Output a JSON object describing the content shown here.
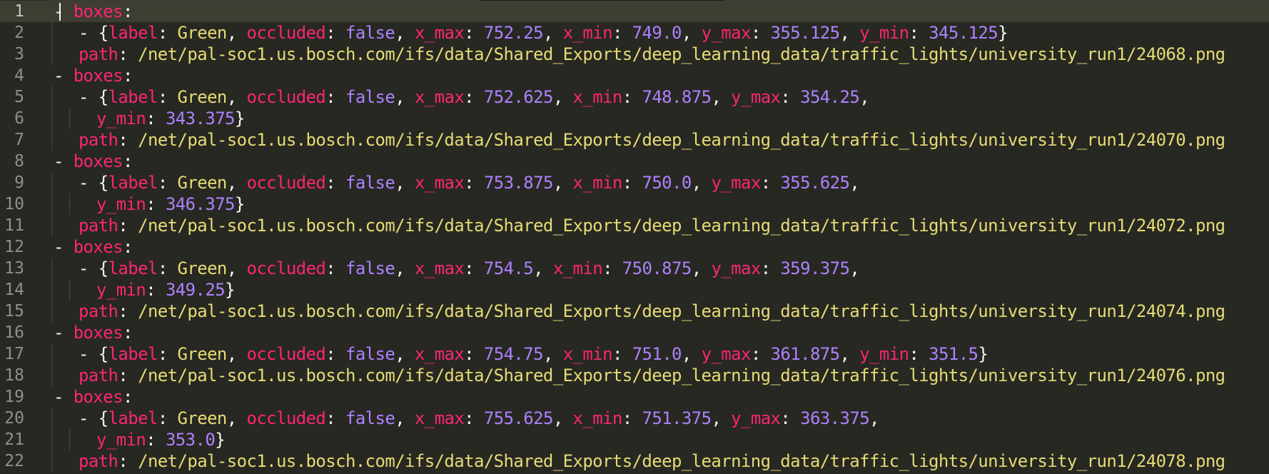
{
  "editor": {
    "active_line": 1,
    "lines": [
      {
        "n": "1",
        "indent": 0,
        "tokens": [
          [
            "p",
            "- "
          ],
          [
            "k",
            "boxes"
          ],
          [
            "p",
            ":"
          ]
        ]
      },
      {
        "n": "2",
        "indent": 1,
        "tokens": [
          [
            "p",
            "- {"
          ],
          [
            "k",
            "label"
          ],
          [
            "p",
            ": "
          ],
          [
            "s",
            "Green"
          ],
          [
            "p",
            ", "
          ],
          [
            "k",
            "occluded"
          ],
          [
            "p",
            ": "
          ],
          [
            "n",
            "false"
          ],
          [
            "p",
            ", "
          ],
          [
            "k",
            "x_max"
          ],
          [
            "p",
            ": "
          ],
          [
            "n",
            "752.25"
          ],
          [
            "p",
            ", "
          ],
          [
            "k",
            "x_min"
          ],
          [
            "p",
            ": "
          ],
          [
            "n",
            "749.0"
          ],
          [
            "p",
            ", "
          ],
          [
            "k",
            "y_max"
          ],
          [
            "p",
            ": "
          ],
          [
            "n",
            "355.125"
          ],
          [
            "p",
            ", "
          ],
          [
            "k",
            "y_min"
          ],
          [
            "p",
            ": "
          ],
          [
            "n",
            "345.125"
          ],
          [
            "p",
            "}"
          ]
        ]
      },
      {
        "n": "3",
        "indent": 1,
        "tokens": [
          [
            "k",
            "path"
          ],
          [
            "p",
            ": "
          ],
          [
            "s",
            "/net/pal-soc1.us.bosch.com/ifs/data/Shared_Exports/deep_learning_data/traffic_lights/university_run1/24068.png"
          ]
        ]
      },
      {
        "n": "4",
        "indent": 0,
        "tokens": [
          [
            "p",
            "- "
          ],
          [
            "k",
            "boxes"
          ],
          [
            "p",
            ":"
          ]
        ]
      },
      {
        "n": "5",
        "indent": 1,
        "tokens": [
          [
            "p",
            "- {"
          ],
          [
            "k",
            "label"
          ],
          [
            "p",
            ": "
          ],
          [
            "s",
            "Green"
          ],
          [
            "p",
            ", "
          ],
          [
            "k",
            "occluded"
          ],
          [
            "p",
            ": "
          ],
          [
            "n",
            "false"
          ],
          [
            "p",
            ", "
          ],
          [
            "k",
            "x_max"
          ],
          [
            "p",
            ": "
          ],
          [
            "n",
            "752.625"
          ],
          [
            "p",
            ", "
          ],
          [
            "k",
            "x_min"
          ],
          [
            "p",
            ": "
          ],
          [
            "n",
            "748.875"
          ],
          [
            "p",
            ", "
          ],
          [
            "k",
            "y_max"
          ],
          [
            "p",
            ": "
          ],
          [
            "n",
            "354.25"
          ],
          [
            "p",
            ","
          ]
        ]
      },
      {
        "n": "6",
        "indent": 2,
        "tokens": [
          [
            "k",
            "y_min"
          ],
          [
            "p",
            ": "
          ],
          [
            "n",
            "343.375"
          ],
          [
            "p",
            "}"
          ]
        ]
      },
      {
        "n": "7",
        "indent": 1,
        "tokens": [
          [
            "k",
            "path"
          ],
          [
            "p",
            ": "
          ],
          [
            "s",
            "/net/pal-soc1.us.bosch.com/ifs/data/Shared_Exports/deep_learning_data/traffic_lights/university_run1/24070.png"
          ]
        ]
      },
      {
        "n": "8",
        "indent": 0,
        "tokens": [
          [
            "p",
            "- "
          ],
          [
            "k",
            "boxes"
          ],
          [
            "p",
            ":"
          ]
        ]
      },
      {
        "n": "9",
        "indent": 1,
        "tokens": [
          [
            "p",
            "- {"
          ],
          [
            "k",
            "label"
          ],
          [
            "p",
            ": "
          ],
          [
            "s",
            "Green"
          ],
          [
            "p",
            ", "
          ],
          [
            "k",
            "occluded"
          ],
          [
            "p",
            ": "
          ],
          [
            "n",
            "false"
          ],
          [
            "p",
            ", "
          ],
          [
            "k",
            "x_max"
          ],
          [
            "p",
            ": "
          ],
          [
            "n",
            "753.875"
          ],
          [
            "p",
            ", "
          ],
          [
            "k",
            "x_min"
          ],
          [
            "p",
            ": "
          ],
          [
            "n",
            "750.0"
          ],
          [
            "p",
            ", "
          ],
          [
            "k",
            "y_max"
          ],
          [
            "p",
            ": "
          ],
          [
            "n",
            "355.625"
          ],
          [
            "p",
            ","
          ]
        ]
      },
      {
        "n": "10",
        "indent": 2,
        "tokens": [
          [
            "k",
            "y_min"
          ],
          [
            "p",
            ": "
          ],
          [
            "n",
            "346.375"
          ],
          [
            "p",
            "}"
          ]
        ]
      },
      {
        "n": "11",
        "indent": 1,
        "tokens": [
          [
            "k",
            "path"
          ],
          [
            "p",
            ": "
          ],
          [
            "s",
            "/net/pal-soc1.us.bosch.com/ifs/data/Shared_Exports/deep_learning_data/traffic_lights/university_run1/24072.png"
          ]
        ]
      },
      {
        "n": "12",
        "indent": 0,
        "tokens": [
          [
            "p",
            "- "
          ],
          [
            "k",
            "boxes"
          ],
          [
            "p",
            ":"
          ]
        ]
      },
      {
        "n": "13",
        "indent": 1,
        "tokens": [
          [
            "p",
            "- {"
          ],
          [
            "k",
            "label"
          ],
          [
            "p",
            ": "
          ],
          [
            "s",
            "Green"
          ],
          [
            "p",
            ", "
          ],
          [
            "k",
            "occluded"
          ],
          [
            "p",
            ": "
          ],
          [
            "n",
            "false"
          ],
          [
            "p",
            ", "
          ],
          [
            "k",
            "x_max"
          ],
          [
            "p",
            ": "
          ],
          [
            "n",
            "754.5"
          ],
          [
            "p",
            ", "
          ],
          [
            "k",
            "x_min"
          ],
          [
            "p",
            ": "
          ],
          [
            "n",
            "750.875"
          ],
          [
            "p",
            ", "
          ],
          [
            "k",
            "y_max"
          ],
          [
            "p",
            ": "
          ],
          [
            "n",
            "359.375"
          ],
          [
            "p",
            ","
          ]
        ]
      },
      {
        "n": "14",
        "indent": 2,
        "tokens": [
          [
            "k",
            "y_min"
          ],
          [
            "p",
            ": "
          ],
          [
            "n",
            "349.25"
          ],
          [
            "p",
            "}"
          ]
        ]
      },
      {
        "n": "15",
        "indent": 1,
        "tokens": [
          [
            "k",
            "path"
          ],
          [
            "p",
            ": "
          ],
          [
            "s",
            "/net/pal-soc1.us.bosch.com/ifs/data/Shared_Exports/deep_learning_data/traffic_lights/university_run1/24074.png"
          ]
        ]
      },
      {
        "n": "16",
        "indent": 0,
        "tokens": [
          [
            "p",
            "- "
          ],
          [
            "k",
            "boxes"
          ],
          [
            "p",
            ":"
          ]
        ]
      },
      {
        "n": "17",
        "indent": 1,
        "tokens": [
          [
            "p",
            "- {"
          ],
          [
            "k",
            "label"
          ],
          [
            "p",
            ": "
          ],
          [
            "s",
            "Green"
          ],
          [
            "p",
            ", "
          ],
          [
            "k",
            "occluded"
          ],
          [
            "p",
            ": "
          ],
          [
            "n",
            "false"
          ],
          [
            "p",
            ", "
          ],
          [
            "k",
            "x_max"
          ],
          [
            "p",
            ": "
          ],
          [
            "n",
            "754.75"
          ],
          [
            "p",
            ", "
          ],
          [
            "k",
            "x_min"
          ],
          [
            "p",
            ": "
          ],
          [
            "n",
            "751.0"
          ],
          [
            "p",
            ", "
          ],
          [
            "k",
            "y_max"
          ],
          [
            "p",
            ": "
          ],
          [
            "n",
            "361.875"
          ],
          [
            "p",
            ", "
          ],
          [
            "k",
            "y_min"
          ],
          [
            "p",
            ": "
          ],
          [
            "n",
            "351.5"
          ],
          [
            "p",
            "}"
          ]
        ]
      },
      {
        "n": "18",
        "indent": 1,
        "tokens": [
          [
            "k",
            "path"
          ],
          [
            "p",
            ": "
          ],
          [
            "s",
            "/net/pal-soc1.us.bosch.com/ifs/data/Shared_Exports/deep_learning_data/traffic_lights/university_run1/24076.png"
          ]
        ]
      },
      {
        "n": "19",
        "indent": 0,
        "tokens": [
          [
            "p",
            "- "
          ],
          [
            "k",
            "boxes"
          ],
          [
            "p",
            ":"
          ]
        ]
      },
      {
        "n": "20",
        "indent": 1,
        "tokens": [
          [
            "p",
            "- {"
          ],
          [
            "k",
            "label"
          ],
          [
            "p",
            ": "
          ],
          [
            "s",
            "Green"
          ],
          [
            "p",
            ", "
          ],
          [
            "k",
            "occluded"
          ],
          [
            "p",
            ": "
          ],
          [
            "n",
            "false"
          ],
          [
            "p",
            ", "
          ],
          [
            "k",
            "x_max"
          ],
          [
            "p",
            ": "
          ],
          [
            "n",
            "755.625"
          ],
          [
            "p",
            ", "
          ],
          [
            "k",
            "x_min"
          ],
          [
            "p",
            ": "
          ],
          [
            "n",
            "751.375"
          ],
          [
            "p",
            ", "
          ],
          [
            "k",
            "y_max"
          ],
          [
            "p",
            ": "
          ],
          [
            "n",
            "363.375"
          ],
          [
            "p",
            ","
          ]
        ]
      },
      {
        "n": "21",
        "indent": 2,
        "tokens": [
          [
            "k",
            "y_min"
          ],
          [
            "p",
            ": "
          ],
          [
            "n",
            "353.0"
          ],
          [
            "p",
            "}"
          ]
        ]
      },
      {
        "n": "22",
        "indent": 1,
        "tokens": [
          [
            "k",
            "path"
          ],
          [
            "p",
            ": "
          ],
          [
            "s",
            "/net/pal-soc1.us.bosch.com/ifs/data/Shared_Exports/deep_learning_data/traffic_lights/university_run1/24078.png"
          ]
        ]
      }
    ]
  },
  "colors": {
    "background": "#272822",
    "active_line": "#3e3d32",
    "keyword": "#f92672",
    "number": "#ae81ff",
    "string": "#e6db74",
    "punctuation": "#f8f8f2",
    "gutter_text": "#90908a"
  }
}
